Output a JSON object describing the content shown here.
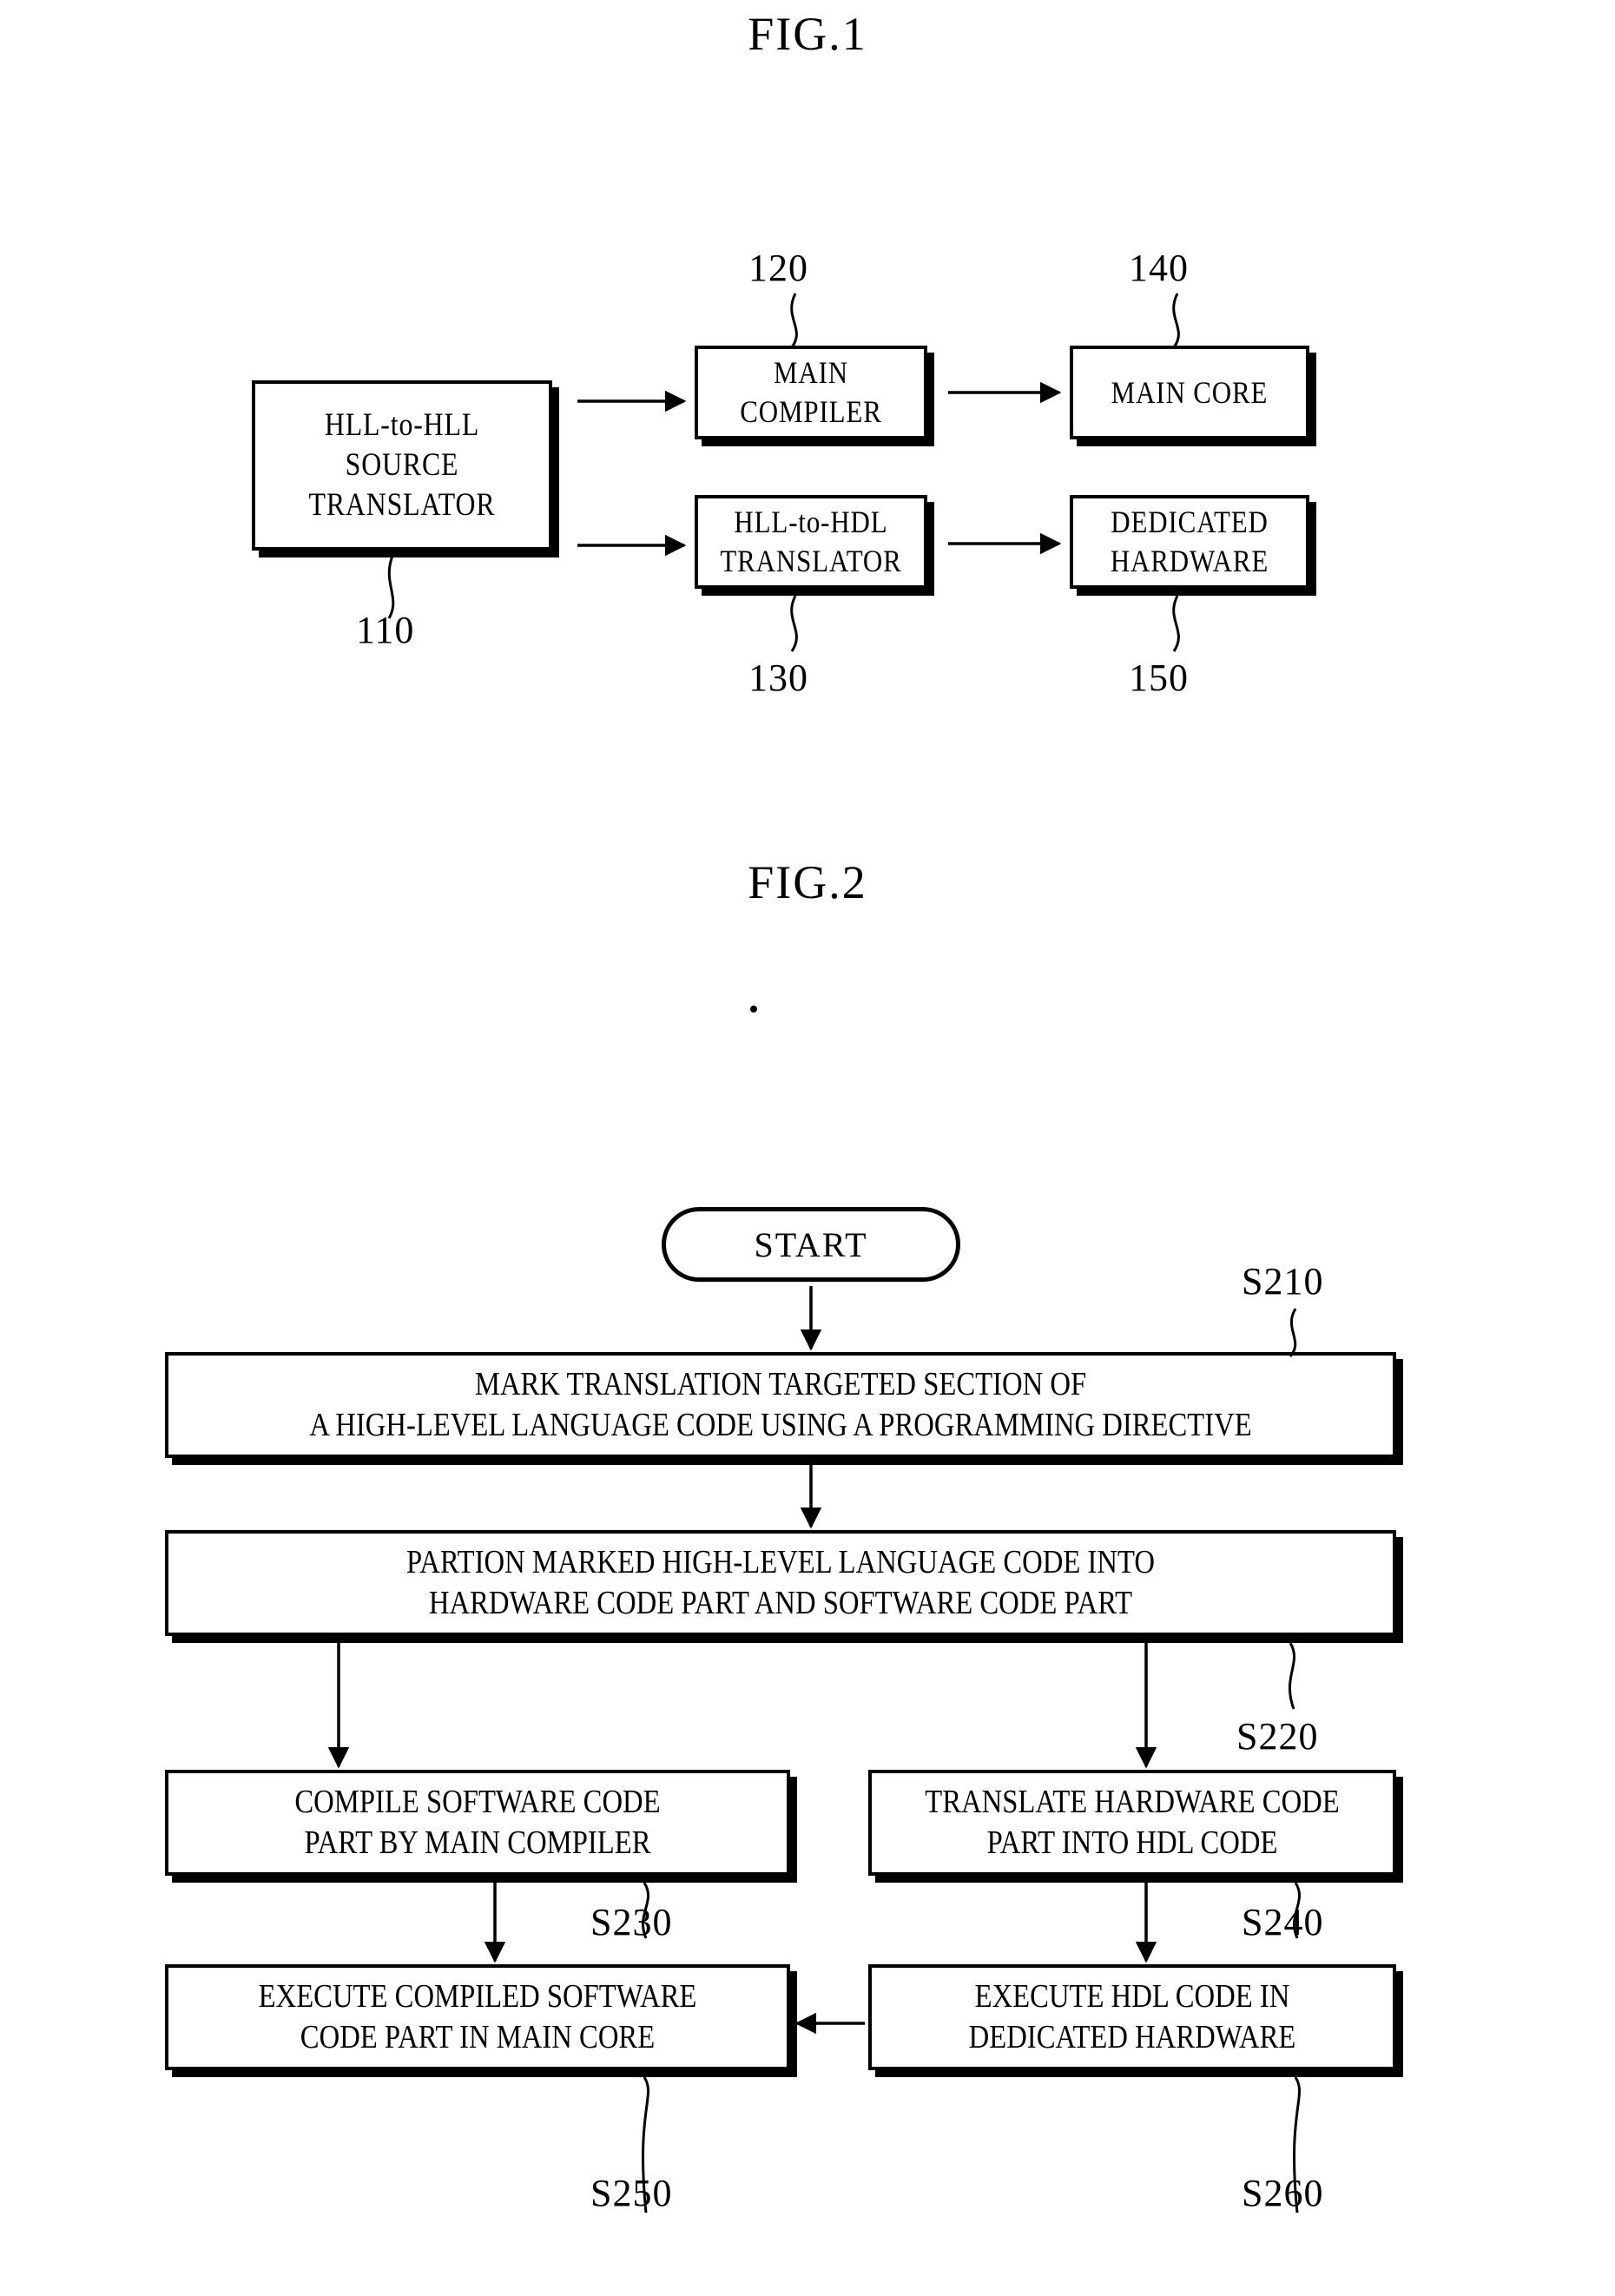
{
  "figures": [
    {
      "id": "fig1",
      "title": "FIG.1",
      "type": "block-diagram",
      "blocks": [
        {
          "ref": "110",
          "lines": [
            "HLL-to-HLL",
            "SOURCE",
            "TRANSLATOR"
          ]
        },
        {
          "ref": "120",
          "lines": [
            "MAIN",
            "COMPILER"
          ]
        },
        {
          "ref": "130",
          "lines": [
            "HLL-to-HDL",
            "TRANSLATOR"
          ]
        },
        {
          "ref": "140",
          "lines": [
            "MAIN CORE"
          ]
        },
        {
          "ref": "150",
          "lines": [
            "DEDICATED",
            "HARDWARE"
          ]
        }
      ],
      "connections": [
        {
          "from": "110",
          "to": "120"
        },
        {
          "from": "110",
          "to": "130"
        },
        {
          "from": "120",
          "to": "140"
        },
        {
          "from": "130",
          "to": "150"
        }
      ]
    },
    {
      "id": "fig2",
      "title": "FIG.2",
      "type": "flowchart",
      "start_label": "START",
      "steps": [
        {
          "ref": "S210",
          "lines": [
            "MARK TRANSLATION TARGETED SECTION OF",
            "A HIGH-LEVEL LANGUAGE CODE USING A PROGRAMMING DIRECTIVE"
          ]
        },
        {
          "ref": "S220",
          "lines": [
            "PARTION MARKED HIGH-LEVEL LANGUAGE CODE INTO",
            "HARDWARE CODE PART AND SOFTWARE CODE PART"
          ]
        },
        {
          "ref": "S230",
          "lines": [
            "COMPILE SOFTWARE CODE",
            "PART BY MAIN COMPILER"
          ]
        },
        {
          "ref": "S240",
          "lines": [
            "TRANSLATE HARDWARE CODE",
            "PART INTO HDL CODE"
          ]
        },
        {
          "ref": "S250",
          "lines": [
            "EXECUTE COMPILED SOFTWARE",
            "CODE PART IN MAIN CORE"
          ]
        },
        {
          "ref": "S260",
          "lines": [
            "EXECUTE HDL CODE IN",
            "DEDICATED HARDWARE"
          ]
        }
      ],
      "connections": [
        {
          "from": "START",
          "to": "S210"
        },
        {
          "from": "S210",
          "to": "S220"
        },
        {
          "from": "S220",
          "to": "S230"
        },
        {
          "from": "S220",
          "to": "S240"
        },
        {
          "from": "S230",
          "to": "S250"
        },
        {
          "from": "S240",
          "to": "S260"
        },
        {
          "from": "S260",
          "to": "S250"
        }
      ]
    }
  ],
  "fig1": {
    "title": "FIG.1",
    "box110": {
      "line1": "HLL-to-HLL",
      "line2": "SOURCE",
      "line3": "TRANSLATOR",
      "ref": "110"
    },
    "box120": {
      "line1": "MAIN",
      "line2": "COMPILER",
      "ref": "120"
    },
    "box130": {
      "line1": "HLL-to-HDL",
      "line2": "TRANSLATOR",
      "ref": "130"
    },
    "box140": {
      "line1": "MAIN CORE",
      "ref": "140"
    },
    "box150": {
      "line1": "DEDICATED",
      "line2": "HARDWARE",
      "ref": "150"
    }
  },
  "fig2": {
    "title": "FIG.2",
    "start": "START",
    "s210": {
      "line1": "MARK TRANSLATION TARGETED SECTION OF",
      "line2": "A HIGH-LEVEL LANGUAGE CODE USING A PROGRAMMING DIRECTIVE",
      "ref": "S210"
    },
    "s220": {
      "line1": "PARTION MARKED HIGH-LEVEL LANGUAGE CODE INTO",
      "line2": "HARDWARE CODE PART AND SOFTWARE CODE PART",
      "ref": "S220"
    },
    "s230": {
      "line1": "COMPILE SOFTWARE CODE",
      "line2": "PART BY MAIN COMPILER",
      "ref": "S230"
    },
    "s240": {
      "line1": "TRANSLATE HARDWARE CODE",
      "line2": "PART INTO HDL CODE",
      "ref": "S240"
    },
    "s250": {
      "line1": "EXECUTE COMPILED SOFTWARE",
      "line2": "CODE PART IN MAIN CORE",
      "ref": "S250"
    },
    "s260": {
      "line1": "EXECUTE HDL CODE IN",
      "line2": "DEDICATED HARDWARE",
      "ref": "S260"
    }
  },
  "colors": {
    "ink": "#000000",
    "paper": "#ffffff"
  }
}
